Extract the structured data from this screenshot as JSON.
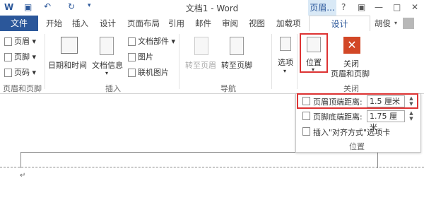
{
  "title_bar": {
    "doc_title": "文档1 - Word",
    "context_tab": "页眉...",
    "help": "?",
    "controls": [
      "▣",
      "—",
      "□",
      "✕"
    ]
  },
  "tabs": [
    "文件",
    "开始",
    "插入",
    "设计",
    "页面布局",
    "引用",
    "邮件",
    "审阅",
    "视图",
    "加载项",
    "设计"
  ],
  "user": {
    "name": "胡俊"
  },
  "ribbon": {
    "header_footer_group": {
      "items": [
        "页眉",
        "页脚",
        "页码"
      ],
      "label": "页眉和页脚"
    },
    "insert_group": {
      "date_time": "日期和时间",
      "doc_info": "文档信息",
      "doc_parts": "文档部件",
      "picture": "图片",
      "online_picture": "联机图片",
      "label": "插入"
    },
    "nav_group": {
      "goto_header": "转至页眉",
      "goto_footer": "转至页脚",
      "label": "导航"
    },
    "options": {
      "label": "选项"
    },
    "position": {
      "label": "位置"
    },
    "close_group": {
      "close_line1": "关闭",
      "close_line2": "页眉和页脚",
      "label": "关闭"
    }
  },
  "position_panel": {
    "header_top": {
      "label": "页眉顶端距离:",
      "value": "1.5 厘米"
    },
    "footer_bottom": {
      "label": "页脚底端距离:",
      "value": "1.75 厘米"
    },
    "insert_align_tab": "插入\"对齐方式\"选项卡",
    "label": "位置"
  },
  "document": {
    "paragraph_mark": "↵"
  }
}
